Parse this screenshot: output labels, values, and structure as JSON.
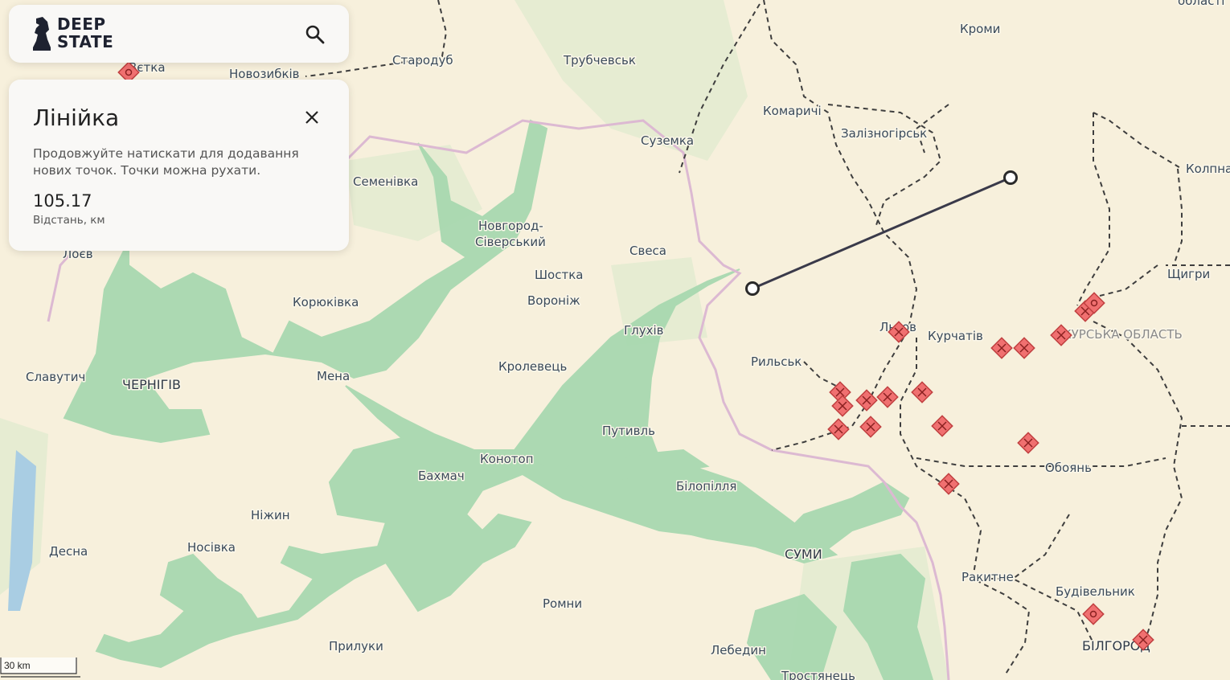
{
  "app": {
    "logo_line1": "DEEP",
    "logo_line2": "STATE"
  },
  "search": {
    "icon": "search-icon"
  },
  "ruler": {
    "title": "Лінійка",
    "description": "Продовжуйте натискати для додавання нових точок. Точки можна рухати.",
    "distance_value": "105.17",
    "distance_label": "Відстань, км",
    "close_icon": "close-icon"
  },
  "scale": {
    "label": "30 km"
  },
  "colors": {
    "land": "#f7f0dc",
    "forest": "#e4ead0",
    "occupied": "#a8d8b0",
    "border_ua": "#d9b8cf",
    "marker": "#f07070",
    "ruler_line": "#3a3a4a"
  },
  "cities": [
    {
      "name": "Стародуб"
    },
    {
      "name": "Трубчевськ"
    },
    {
      "name": "Кроми"
    },
    {
      "name": "Новозибків"
    },
    {
      "name": "Вєтка"
    },
    {
      "name": "Комаричі"
    },
    {
      "name": "Залізногірськ"
    },
    {
      "name": "Суземка"
    },
    {
      "name": "Семенівка"
    },
    {
      "name": "Колпна"
    },
    {
      "name": "Новгород-"
    },
    {
      "name": "Сіверський"
    },
    {
      "name": "Свеса"
    },
    {
      "name": "Шостка"
    },
    {
      "name": "Лоєв"
    },
    {
      "name": "Вороніж"
    },
    {
      "name": "Корюківка"
    },
    {
      "name": "Щигри"
    },
    {
      "name": "Глухів"
    },
    {
      "name": "Льгов"
    },
    {
      "name": "Курчатів"
    },
    {
      "name": "КУРСЬКА ОБЛАСТЬ"
    },
    {
      "name": "Рильськ"
    },
    {
      "name": "Славутич"
    },
    {
      "name": "ЧЕРНІГІВ"
    },
    {
      "name": "Кролевець"
    },
    {
      "name": "Мена"
    },
    {
      "name": "Путивль"
    },
    {
      "name": "Конотоп"
    },
    {
      "name": "Обоянь"
    },
    {
      "name": "Бахмач"
    },
    {
      "name": "Білопілля"
    },
    {
      "name": "Ніжин"
    },
    {
      "name": "Десна"
    },
    {
      "name": "Носівка"
    },
    {
      "name": "СУМИ"
    },
    {
      "name": "Ромни"
    },
    {
      "name": "Ракитне"
    },
    {
      "name": "Будівельник"
    },
    {
      "name": "Прилуки"
    },
    {
      "name": "Лебедин"
    },
    {
      "name": "БІЛГОРОД"
    },
    {
      "name": "Тростянець"
    },
    {
      "name": "області"
    }
  ]
}
